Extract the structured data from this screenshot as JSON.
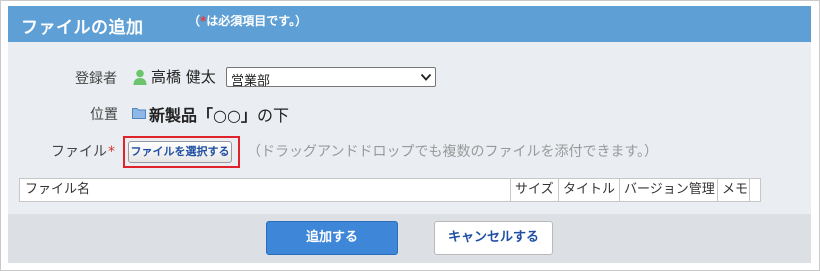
{
  "header": {
    "title": "ファイルの追加",
    "note_open": "（",
    "note_star": "*",
    "note_text": "は必須項目です。）"
  },
  "form": {
    "registrant_label": "登録者",
    "registrant_name": "高橋 健太",
    "department_select": "営業部",
    "location_label": "位置",
    "location_folder": "新製品「○○」",
    "location_suffix": "の下",
    "file_label": "ファイル",
    "file_required_mark": "*",
    "choose_file_button": "ファイルを選択する",
    "drop_hint": "（ドラッグアンドドロップでも複数のファイルを添付できます。）"
  },
  "file_table": {
    "columns": [
      "ファイル名",
      "サイズ",
      "タイトル",
      "バージョン管理",
      "メモ"
    ]
  },
  "footer": {
    "add_button": "追加する",
    "cancel_button": "キャンセルする"
  },
  "colors": {
    "header_bg": "#5e9fd5",
    "body_bg": "#eaeef2",
    "primary_button": "#3d86d8",
    "highlight_border": "#e0222a"
  }
}
